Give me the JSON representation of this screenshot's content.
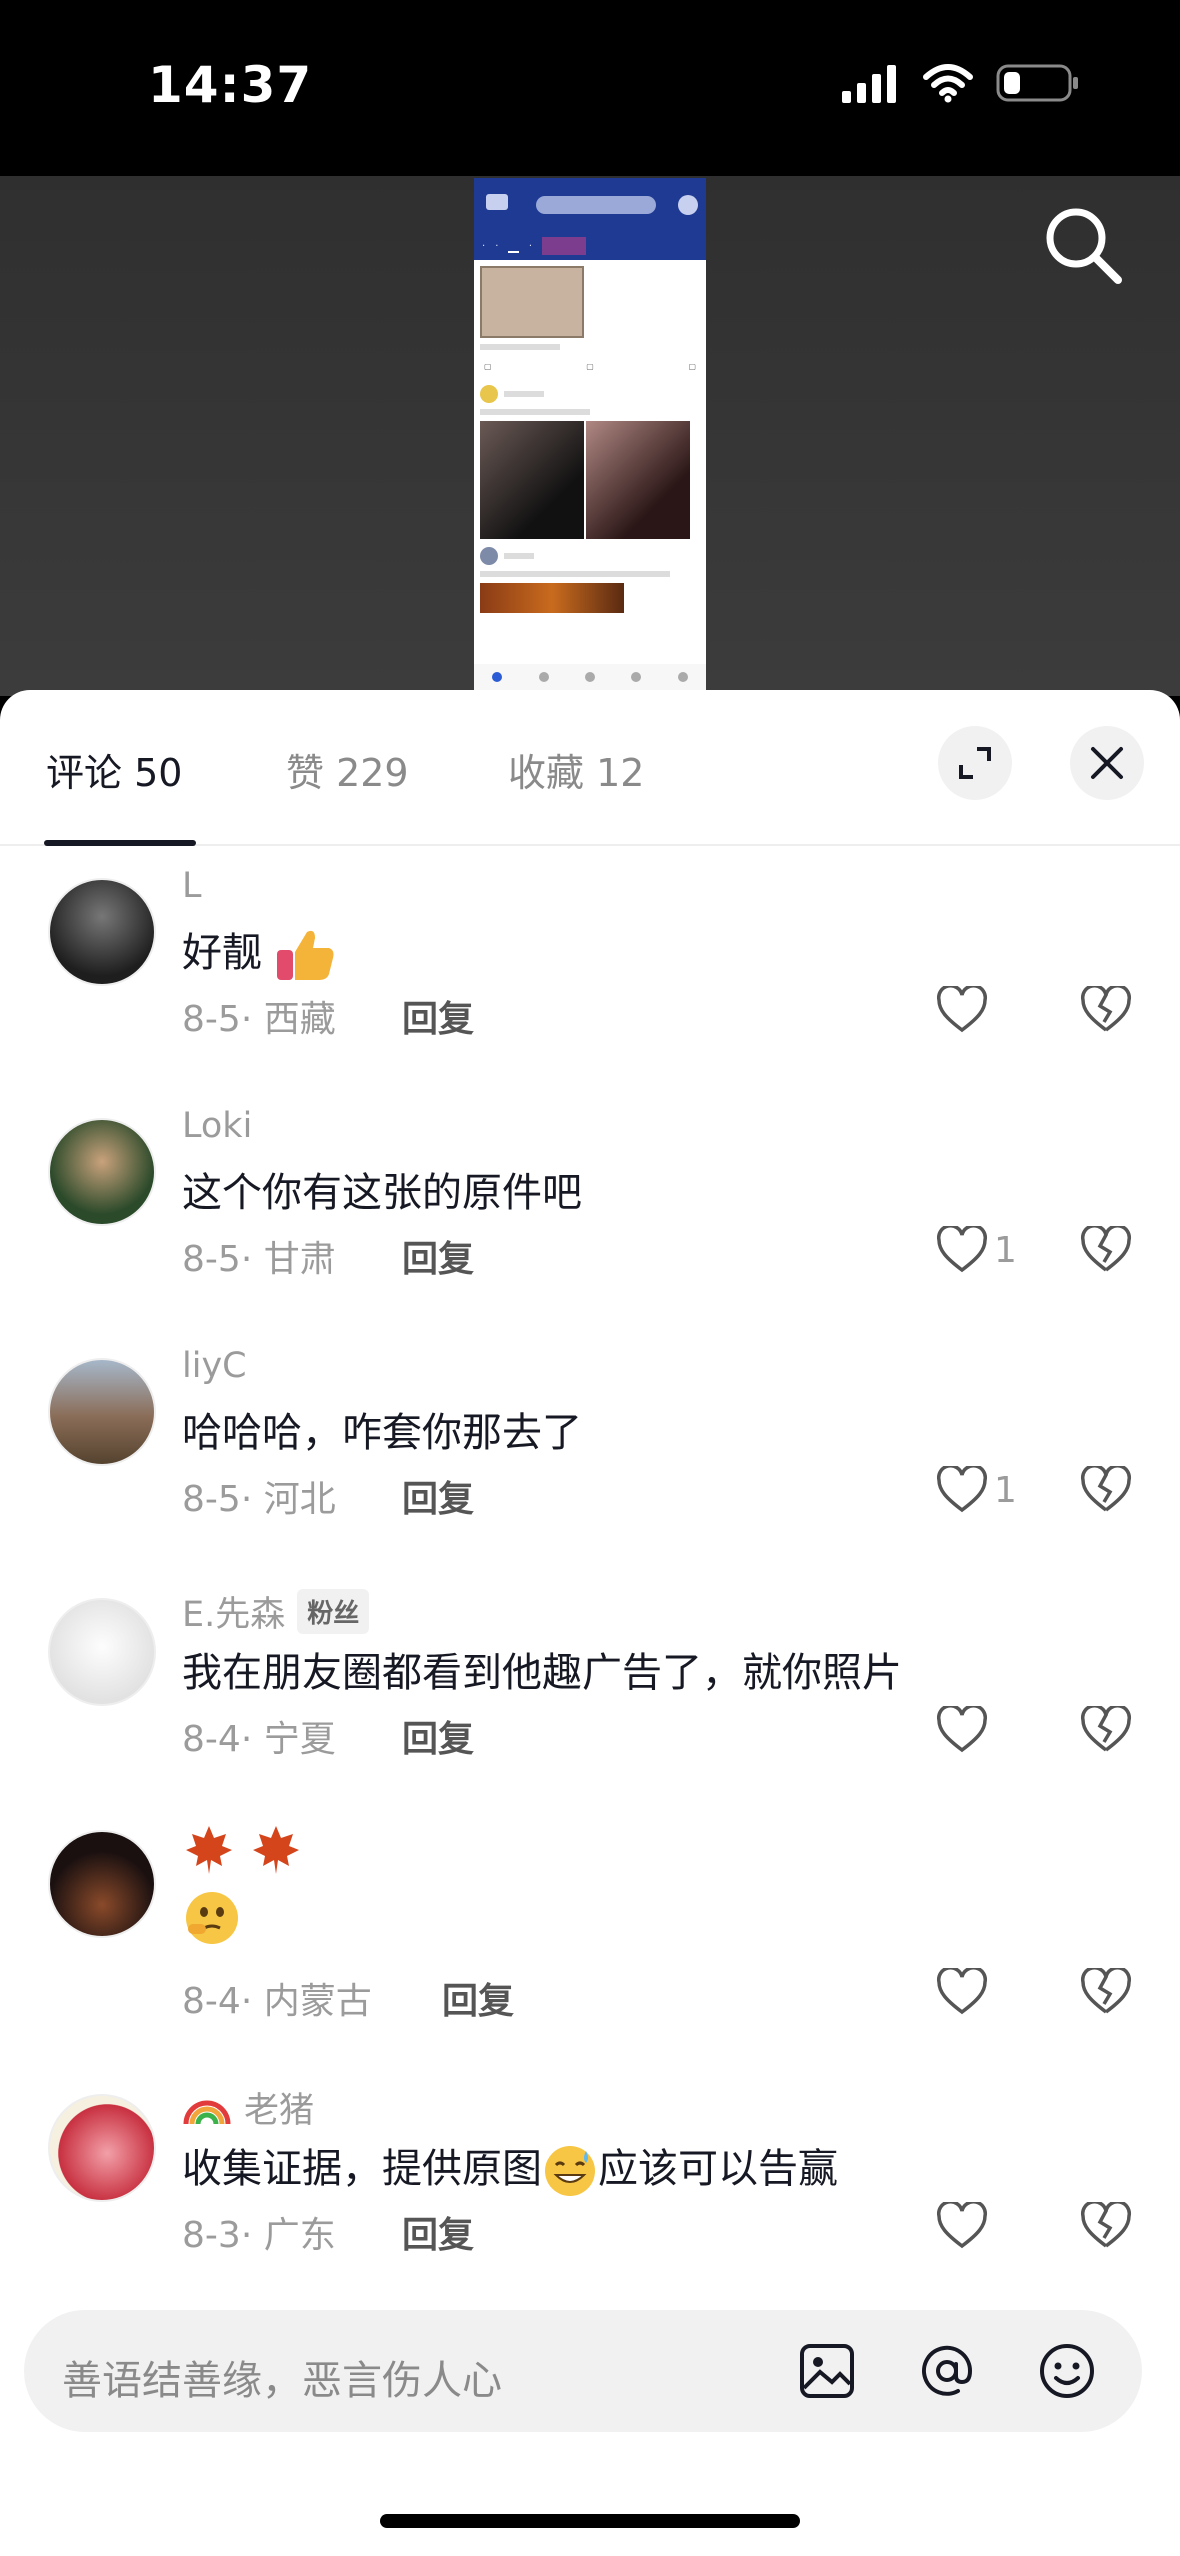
{
  "status_bar": {
    "time": "14:37"
  },
  "tabs": {
    "comments": "评论 50",
    "likes": "赞 229",
    "favorites": "收藏 12"
  },
  "comments": [
    {
      "user": "L",
      "text": "好靓",
      "emoji": "thumbs-up-emoji",
      "date": "8-5",
      "location": "西藏",
      "reply": "回复",
      "likes": ""
    },
    {
      "user": "Loki",
      "text": "这个你有这张的原件吧",
      "date": "8-5",
      "location": "甘肃",
      "reply": "回复",
      "likes": "1"
    },
    {
      "user": "liyC",
      "text": "哈哈哈，咋套你那去了",
      "date": "8-5",
      "location": "河北",
      "reply": "回复",
      "likes": "1"
    },
    {
      "user": "E.先森",
      "badge": "粉丝",
      "text": "我在朋友圈都看到他趣广告了，就你照片",
      "date": "8-4",
      "location": "宁夏",
      "reply": "回复",
      "likes": ""
    },
    {
      "user": "",
      "text": "",
      "emoji": "maple-leaf-emoji, thinking-face-emoji",
      "date": "8-4",
      "location": "内蒙古",
      "reply": "回复",
      "likes": ""
    },
    {
      "user": "老猪",
      "user_prefix_emoji": "rainbow-emoji",
      "text_before": "收集证据，提供原图",
      "text_after": "应该可以告赢",
      "date": "8-3",
      "location": "广东",
      "reply": "回复",
      "likes": ""
    }
  ],
  "input": {
    "placeholder": "善语结善缘，恶言伤人心"
  },
  "colors": {
    "text": "#161823",
    "muted": "#9b9b9b",
    "sheet_bg": "#ffffff",
    "input_bg": "#f1f1f2"
  }
}
